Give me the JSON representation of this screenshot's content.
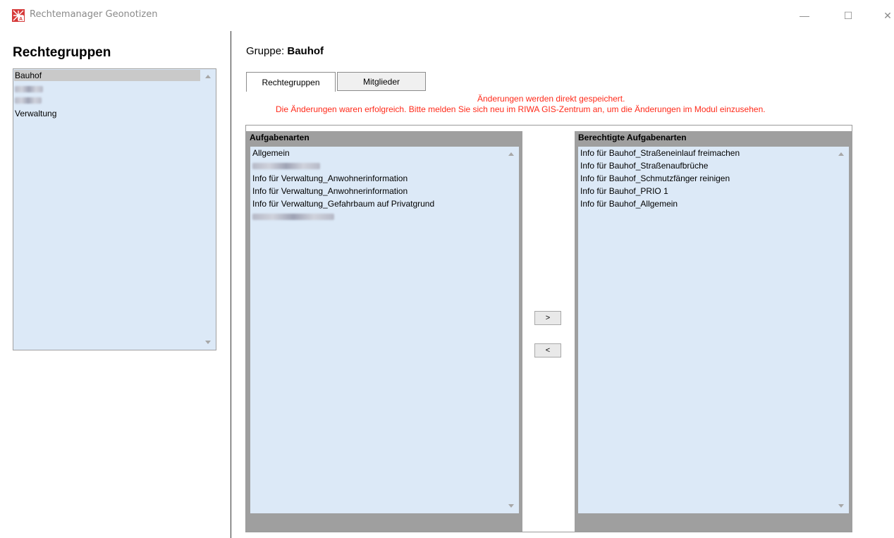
{
  "window": {
    "title": "Rechtemanager Geonotizen",
    "minimize": "—",
    "maximize": "☐",
    "close": "✕"
  },
  "sidebar": {
    "heading": "Rechtegruppen",
    "groups": [
      {
        "label": "Bauhof",
        "selected": true
      },
      {
        "label": "",
        "blurred": true
      },
      {
        "label": "",
        "blurred": true
      },
      {
        "label": "Verwaltung"
      }
    ]
  },
  "main": {
    "group_prefix": "Gruppe:",
    "group_name": "Bauhof",
    "tabs": [
      {
        "label": "Rechtegruppen",
        "active": true
      },
      {
        "label": "Mitglieder",
        "active": false
      }
    ],
    "notice_line1": "Änderungen werden direkt gespeichert.",
    "notice_line2": "Die Änderungen waren erfolgreich. Bitte melden Sie sich neu im RIWA GIS-Zentrum an, um die Änderungen im Modul einzusehen.",
    "left_list": {
      "header": "Aufgabenarten",
      "items": [
        "Allgemein",
        "",
        "Info für Verwaltung_Anwohnerinformation",
        "Info für Verwaltung_Anwohnerinformation",
        "Info für Verwaltung_Gefahrbaum auf Privatgrund",
        ""
      ]
    },
    "right_list": {
      "header": "Berechtigte Aufgabenarten",
      "items": [
        "Info für Bauhof_Straßeneinlauf freimachen",
        "Info für Bauhof_Straßenaufbrüche",
        "Info für Bauhof_Schmutzfänger reinigen",
        "Info für Bauhof_PRIO 1",
        "Info für Bauhof_Allgemein"
      ]
    },
    "move_right_label": ">",
    "move_left_label": "<"
  },
  "colors": {
    "list_bg": "#dce9f7",
    "panel_bg": "#9f9f9f",
    "notice": "#ff2a1a"
  }
}
